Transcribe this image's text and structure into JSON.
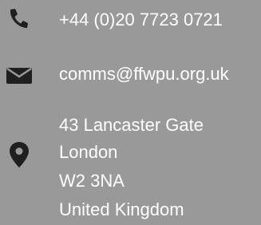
{
  "contact": {
    "phone": {
      "icon": "phone-icon",
      "text": "+44 (0)20 7723 0721"
    },
    "email": {
      "icon": "envelope-icon",
      "text": "comms@ffwpu.org.uk"
    },
    "address": {
      "icon": "map-pin-icon",
      "lines": [
        "43 Lancaster Gate",
        "London",
        "W2 3NA",
        "United Kingdom"
      ]
    }
  },
  "colors": {
    "background": "#999999",
    "text": "#ffffff",
    "icon": "#1f1f1f"
  }
}
